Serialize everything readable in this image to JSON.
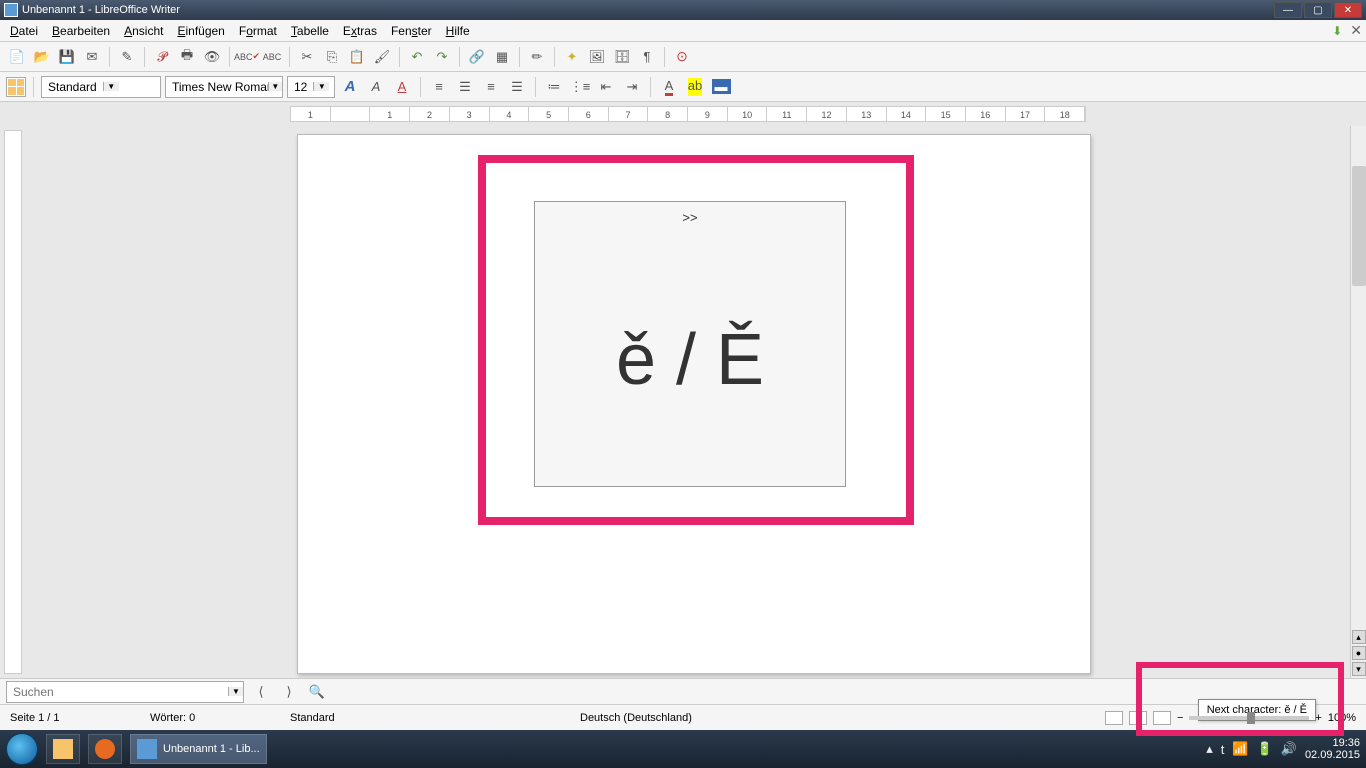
{
  "title": "Unbenannt 1 - LibreOffice Writer",
  "menu": {
    "file": "Datei",
    "edit": "Bearbeiten",
    "view": "Ansicht",
    "insert": "Einfügen",
    "format": "Format",
    "table": "Tabelle",
    "extras": "Extras",
    "window": "Fenster",
    "help": "Hilfe"
  },
  "format_bar": {
    "style": "Standard",
    "font": "Times New Roman",
    "size": "12"
  },
  "ruler": [
    "1",
    "",
    "1",
    "2",
    "3",
    "4",
    "5",
    "6",
    "7",
    "8",
    "9",
    "10",
    "11",
    "12",
    "13",
    "14",
    "15",
    "16",
    "17",
    "18"
  ],
  "char_preview": {
    "next_symbol": ">>",
    "glyphs": "ě / Ě"
  },
  "find": {
    "placeholder": "Suchen"
  },
  "status": {
    "page": "Seite 1 / 1",
    "words": "Wörter: 0",
    "style": "Standard",
    "language": "Deutsch (Deutschland)",
    "zoom": "100%"
  },
  "tooltip": "Next character: ě / Ě",
  "taskbar": {
    "app_label": "Unbenannt 1 - Lib...",
    "time": "19:36",
    "date": "02.09.2015"
  }
}
